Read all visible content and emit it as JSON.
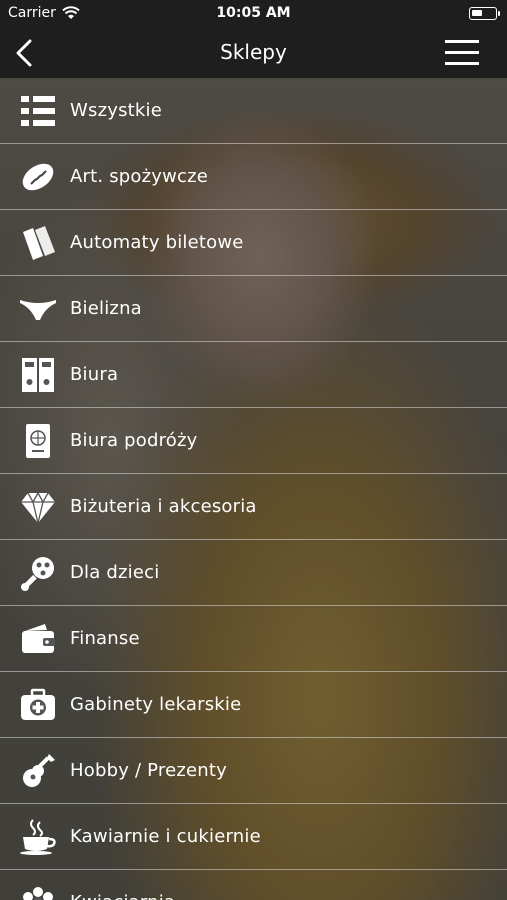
{
  "status_bar": {
    "carrier": "Carrier",
    "time": "10:05 AM"
  },
  "nav": {
    "title": "Sklepy"
  },
  "categories": [
    {
      "label": "Wszystkie",
      "icon": "list-icon"
    },
    {
      "label": "Art. spożywcze",
      "icon": "bread-icon"
    },
    {
      "label": "Automaty biletowe",
      "icon": "tickets-icon"
    },
    {
      "label": "Bielizna",
      "icon": "underwear-icon"
    },
    {
      "label": "Biura",
      "icon": "binders-icon"
    },
    {
      "label": "Biura podróży",
      "icon": "passport-icon"
    },
    {
      "label": "Biżuteria i akcesoria",
      "icon": "diamond-icon"
    },
    {
      "label": "Dla dzieci",
      "icon": "rattle-icon"
    },
    {
      "label": "Finanse",
      "icon": "wallet-icon"
    },
    {
      "label": "Gabinety lekarskie",
      "icon": "medical-kit-icon"
    },
    {
      "label": "Hobby / Prezenty",
      "icon": "guitar-icon"
    },
    {
      "label": "Kawiarnie i cukiernie",
      "icon": "coffee-cup-icon"
    },
    {
      "label": "Kwiaciarnia",
      "icon": "flower-icon"
    }
  ]
}
